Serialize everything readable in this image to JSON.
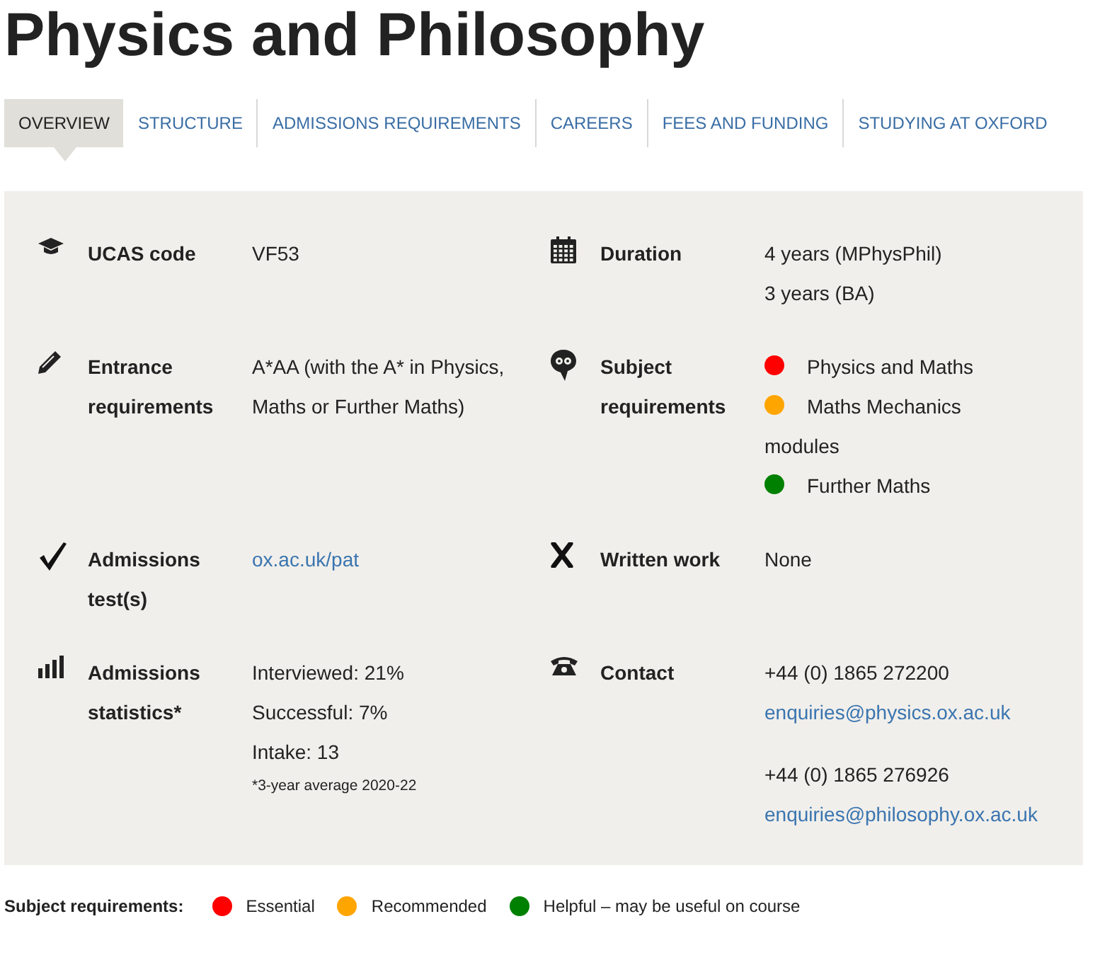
{
  "title": "Physics and Philosophy",
  "tabs": [
    {
      "label": "OVERVIEW",
      "selected": true
    },
    {
      "label": "STRUCTURE",
      "selected": false
    },
    {
      "label": "ADMISSIONS REQUIREMENTS",
      "selected": false
    },
    {
      "label": "CAREERS",
      "selected": false
    },
    {
      "label": "FEES AND FUNDING",
      "selected": false
    },
    {
      "label": "STUDYING AT OXFORD",
      "selected": false
    }
  ],
  "facts": [
    {
      "kind": "cap",
      "label": "UCAS code",
      "blocks": [
        [
          {
            "kind": "text",
            "text": "VF53"
          }
        ]
      ]
    },
    {
      "kind": "calendar",
      "label": "Duration",
      "blocks": [
        [
          {
            "kind": "text",
            "text": "4 years (MPhysPhil)"
          },
          {
            "kind": "text",
            "text": "3 years (BA)"
          }
        ]
      ]
    },
    {
      "kind": "pencil",
      "label": "Entrance requirements",
      "blocks": [
        [
          {
            "kind": "text",
            "text": "A*AA (with the A* in Physics, Maths or Further Maths)"
          }
        ]
      ]
    },
    {
      "kind": "head",
      "label": "Subject requirements",
      "blocks": [
        [
          {
            "kind": "dot",
            "color": "#ff0000",
            "text": "Physics and Maths"
          },
          {
            "kind": "dot",
            "color": "#ffa500",
            "text": "Maths Mechanics modules"
          },
          {
            "kind": "dot",
            "color": "#008000",
            "text": "Further Maths"
          }
        ]
      ]
    },
    {
      "kind": "check",
      "label": "Admissions test(s)",
      "blocks": [
        [
          {
            "kind": "link",
            "text": "ox.ac.uk/pat"
          }
        ]
      ]
    },
    {
      "kind": "cross",
      "label": "Written work",
      "blocks": [
        [
          {
            "kind": "text",
            "text": "None"
          }
        ]
      ]
    },
    {
      "kind": "bars",
      "label": "Admissions statistics*",
      "blocks": [
        [
          {
            "kind": "text",
            "text": "Interviewed: 21%"
          },
          {
            "kind": "text",
            "text": "Successful: 7%"
          },
          {
            "kind": "text",
            "text": "Intake: 13"
          },
          {
            "kind": "note",
            "text": "*3-year average 2020-22"
          }
        ]
      ]
    },
    {
      "kind": "phone",
      "label": "Contact",
      "blocks": [
        [
          {
            "kind": "text",
            "text": "+44 (0) 1865 272200"
          },
          {
            "kind": "link",
            "text": "enquiries@physics.ox.ac.uk"
          }
        ],
        [
          {
            "kind": "text",
            "text": "+44 (0) 1865 276926"
          },
          {
            "kind": "link",
            "text": "enquiries@philosophy.ox.ac.uk"
          }
        ]
      ]
    }
  ],
  "legend": {
    "label": "Subject requirements:",
    "items": [
      {
        "color": "#ff0000",
        "text": "Essential"
      },
      {
        "color": "#ffa500",
        "text": "Recommended"
      },
      {
        "color": "#008000",
        "text": "Helpful – may be useful on course"
      }
    ]
  }
}
